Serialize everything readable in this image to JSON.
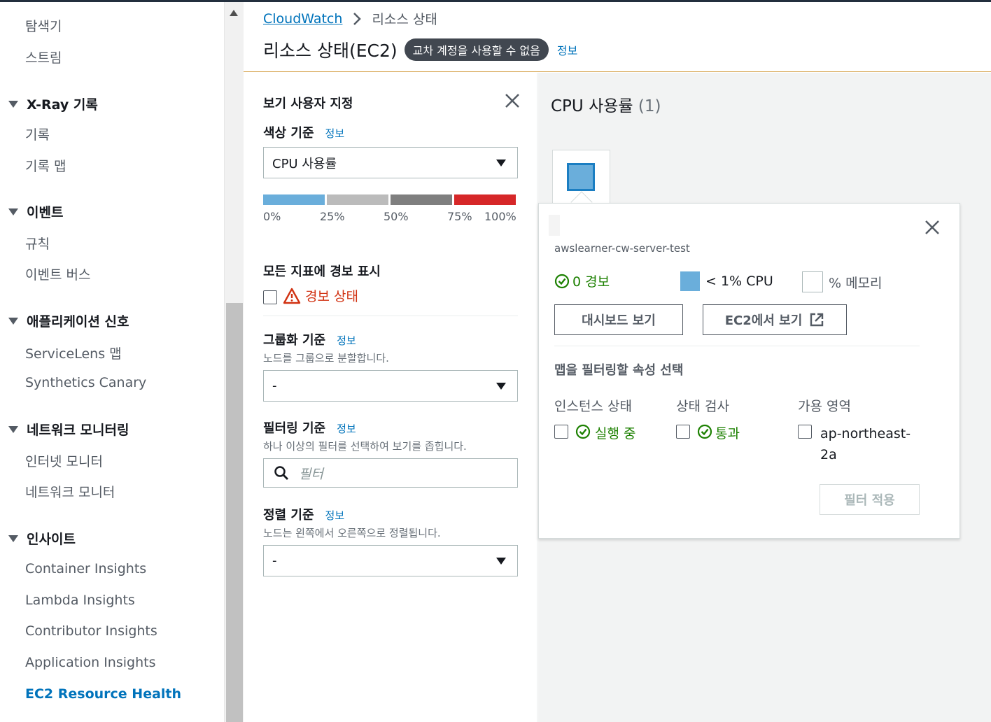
{
  "sidebar": {
    "items": {
      "explorer": "탐색기",
      "streams": "스트림",
      "traces": "기록",
      "trace_map": "기록 맵",
      "rules": "규칙",
      "event_bus": "이벤트 버스",
      "servicelens_map": "ServiceLens 맵",
      "synthetics_canary": "Synthetics Canary",
      "internet_monitor": "인터넷 모니터",
      "network_monitor": "네트워크 모니터",
      "container_insights": "Container Insights",
      "lambda_insights": "Lambda Insights",
      "contributor_insights": "Contributor Insights",
      "application_insights": "Application Insights",
      "ec2_resource_health": "EC2 Resource Health"
    },
    "sections": {
      "xray": "X-Ray 기록",
      "events": "이벤트",
      "app_signals": "애플리케이션 신호",
      "network_monitoring": "네트워크 모니터링",
      "insights": "인사이트"
    }
  },
  "header": {
    "breadcrumb_root": "CloudWatch",
    "breadcrumb_current": "리소스 상태",
    "title": "리소스 상태(EC2)",
    "badge": "교차 계정을 사용할 수 없음",
    "info": "정보"
  },
  "panel": {
    "title": "보기 사용자 지정",
    "color_by": {
      "label": "색상 기준",
      "info": "정보",
      "value": "CPU 사용률"
    },
    "legend": {
      "colors": [
        "#6aaedb",
        "#bbbbbb",
        "#7f7f7f",
        "#d62728"
      ],
      "labels": [
        "0%",
        "25%",
        "50%",
        "75%",
        "100%"
      ]
    },
    "alarms": {
      "label": "모든 지표에 경보 표시",
      "option": "경보 상태"
    },
    "group_by": {
      "label": "그룹화 기준",
      "info": "정보",
      "desc": "노드를 그룹으로 분할합니다.",
      "value": "-"
    },
    "filter_by": {
      "label": "필터링 기준",
      "info": "정보",
      "desc": "하나 이상의 필터를 선택하여 보기를 좁힙니다.",
      "placeholder": "필터"
    },
    "sort_by": {
      "label": "정렬 기준",
      "info": "정보",
      "desc": "노드는 왼쪽에서 오른쪽으로 정렬됩니다.",
      "value": "-"
    }
  },
  "map": {
    "title": "CPU 사용률",
    "count": "(1)",
    "node_color": "#6aaedb"
  },
  "popover": {
    "instance_name": "awslearner-cw-server-test",
    "alarms": "0 경보",
    "cpu": "< 1% CPU",
    "memory": "% 메모리",
    "dashboard_btn": "대시보드 보기",
    "ec2_btn": "EC2에서 보기",
    "filter_section": "맵을 필터링할 속성 선택",
    "columns": {
      "instance_state": "인스턴스 상태",
      "status_check": "상태 검사",
      "az": "가용 영역"
    },
    "options": {
      "running": "실행 중",
      "passed": "통과",
      "az_value_line1": "ap-northeast-",
      "az_value_line2": "2a"
    },
    "apply_btn": "필터 적용"
  }
}
